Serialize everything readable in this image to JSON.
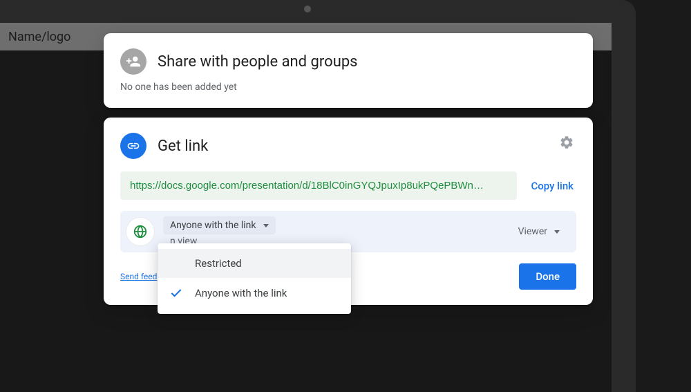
{
  "page": {
    "header_text": "Name/logo"
  },
  "share_card": {
    "title": "Share with people and groups",
    "subtitle": "No one has been added yet"
  },
  "link_card": {
    "title": "Get link",
    "url": "https://docs.google.com/presentation/d/18BlC0inGYQJpuxIp8ukPQePBWn…",
    "copy_label": "Copy link",
    "access_label": "Anyone with the link",
    "access_subtext": "n view",
    "role_label": "Viewer",
    "feedback_label": "Send feed",
    "done_label": "Done"
  },
  "dropdown": {
    "items": [
      {
        "label": "Restricted",
        "selected": false
      },
      {
        "label": "Anyone with the link",
        "selected": true
      }
    ]
  },
  "icons": {
    "person_add": "person-add-icon",
    "link": "link-icon",
    "gear": "gear-icon",
    "globe": "globe-icon",
    "check": "check-icon"
  }
}
